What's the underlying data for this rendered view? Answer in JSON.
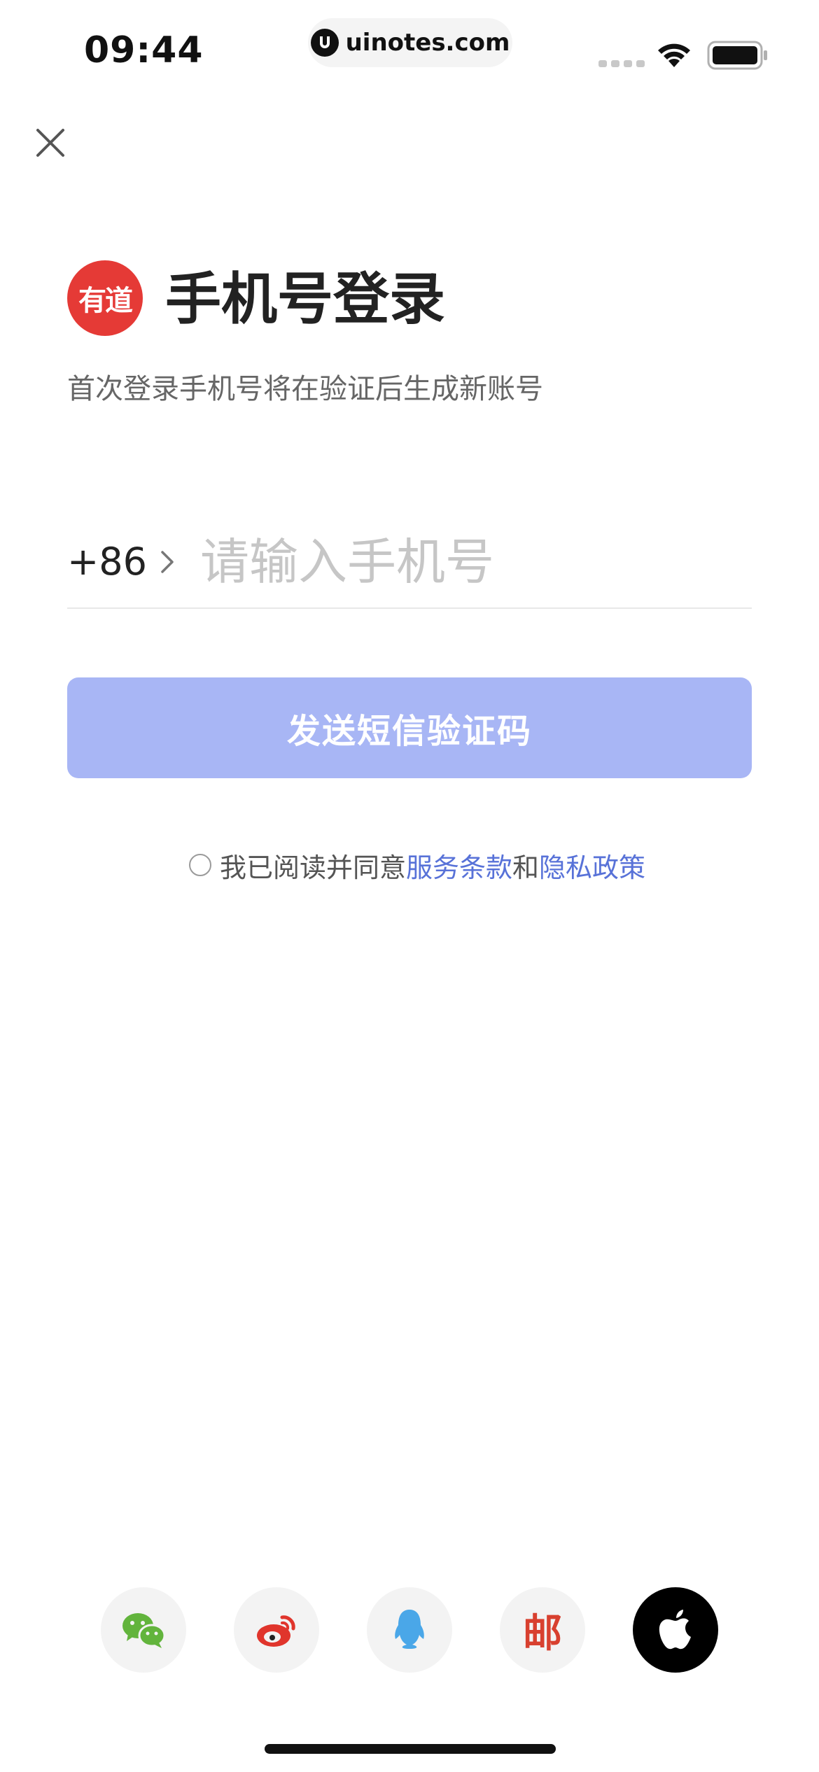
{
  "status_bar": {
    "time": "09:44",
    "url": "uinotes.com"
  },
  "header": {
    "logo_text": "有道",
    "title": "手机号登录",
    "subtitle": "首次登录手机号将在验证后生成新账号"
  },
  "phone": {
    "country_code": "+86",
    "placeholder": "请输入手机号",
    "value": ""
  },
  "send_button": {
    "label": "发送短信验证码",
    "color": "#a8b6f5"
  },
  "agreement": {
    "prefix": "我已阅读并同意",
    "terms_link": "服务条款",
    "conjunction": "和",
    "privacy_link": "隐私政策",
    "checked": false,
    "link_color": "#5872d8"
  },
  "social_logins": [
    {
      "name": "wechat-icon"
    },
    {
      "name": "weibo-icon"
    },
    {
      "name": "qq-icon"
    },
    {
      "name": "mail-icon",
      "glyph": "邮"
    },
    {
      "name": "apple-icon"
    }
  ],
  "colors": {
    "brand_red": "#e53a36"
  }
}
